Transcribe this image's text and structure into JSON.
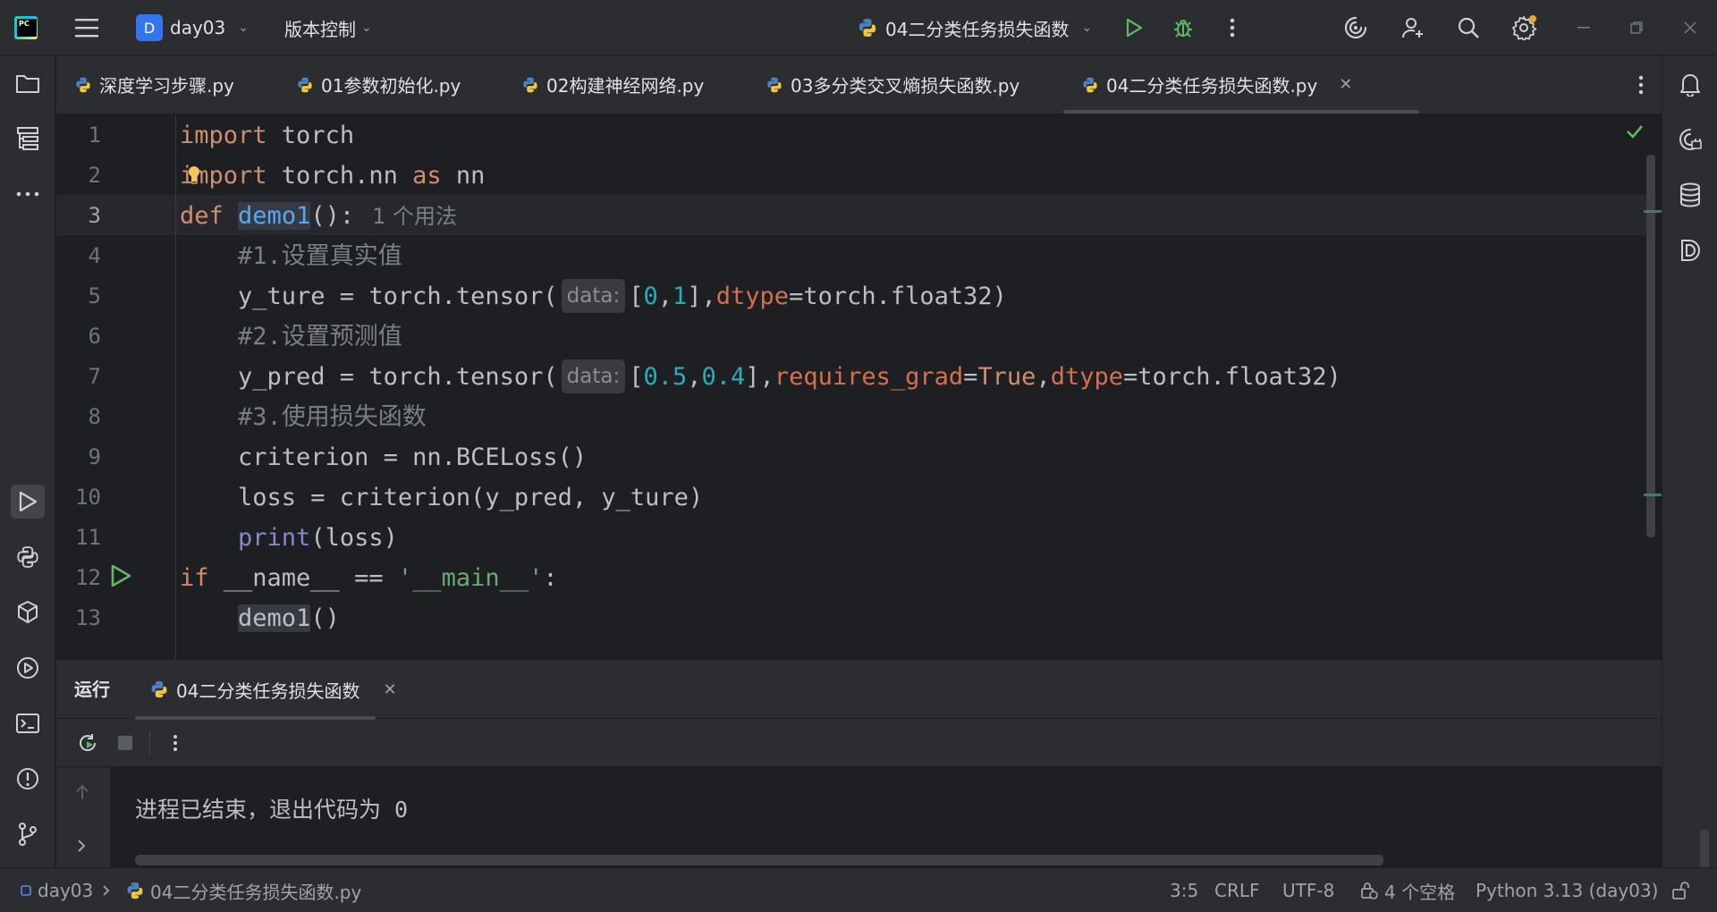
{
  "titlebar": {
    "project_initial": "D",
    "project_name": "day03",
    "vcs_label": "版本控制",
    "run_config": "04二分类任务损失函数"
  },
  "tabs": [
    {
      "label": "深度学习步骤.py"
    },
    {
      "label": "01参数初始化.py"
    },
    {
      "label": "02构建神经网络.py"
    },
    {
      "label": "03多分类交叉熵损失函数.py"
    },
    {
      "label": "04二分类任务损失函数.py",
      "active": true
    }
  ],
  "editor": {
    "line_numbers": [
      "1",
      "2",
      "3",
      "4",
      "5",
      "6",
      "7",
      "8",
      "9",
      "10",
      "11",
      "12",
      "13"
    ],
    "current_line": "3",
    "code": {
      "l1_kw": "import",
      "l1_rest": " torch",
      "l2_kw": "import",
      "l2_mid": " torch.nn ",
      "l2_as": "as",
      "l2_rest": " nn",
      "l3_def": "def",
      "l3_fn": "demo1",
      "l3_rest": "():",
      "l3_usage": "1 个用法",
      "l4_comment": "#1.设置真实值",
      "l5_a": "    y_ture = torch.tensor(",
      "l5_hint": "data:",
      "l5_b": "[",
      "l5_n0": "0",
      "l5_c": ",",
      "l5_n1": "1",
      "l5_d": "],",
      "l5_p": "dtype",
      "l5_e": "=torch.float32)",
      "l6_comment": "#2.设置预测值",
      "l7_a": "    y_pred = torch.tensor(",
      "l7_hint": "data:",
      "l7_b": "[",
      "l7_n0": "0.5",
      "l7_c": ",",
      "l7_n1": "0.4",
      "l7_d": "],",
      "l7_p1": "requires_grad",
      "l7_e": "=",
      "l7_true": "True",
      "l7_f": ",",
      "l7_p2": "dtype",
      "l7_g": "=torch.float32)",
      "l8_comment": "#3.使用损失函数",
      "l9": "    criterion = nn.BCELoss()",
      "l10": "    loss = criterion(y_pred, y_ture)",
      "l11_print": "print",
      "l11_rest": "(loss)",
      "l12_if": "if",
      "l12_mid": " __name__ == ",
      "l12_str": "'__main__'",
      "l12_end": ":",
      "l13_call": "demo1",
      "l13_rest": "()"
    }
  },
  "run_panel": {
    "title": "运行",
    "tab_label": "04二分类任务损失函数",
    "console_output": "进程已结束，退出代码为 0"
  },
  "statusbar": {
    "project": "day03",
    "file": "04二分类任务损失函数.py",
    "position": "3:5",
    "line_ending": "CRLF",
    "encoding": "UTF-8",
    "indent": "4 个空格",
    "interpreter": "Python 3.13 (day03)"
  },
  "colors": {
    "background": "#1e1f22",
    "panel": "#2b2d30",
    "keyword": "#cf8e6d",
    "function": "#56a8f5",
    "number": "#2aacb8",
    "string": "#6aab73",
    "run_green": "#5fb865",
    "accent_blue": "#3574f0"
  },
  "icons": {
    "left_strip": [
      "folder-icon",
      "structure-icon",
      "more-icon",
      "run-icon",
      "python-console-icon",
      "python-packages-icon",
      "services-icon",
      "terminal-icon",
      "problems-icon",
      "git-icon"
    ],
    "right_strip": [
      "notifications-icon",
      "ai-assistant-icon",
      "database-icon",
      "sciview-icon"
    ]
  }
}
